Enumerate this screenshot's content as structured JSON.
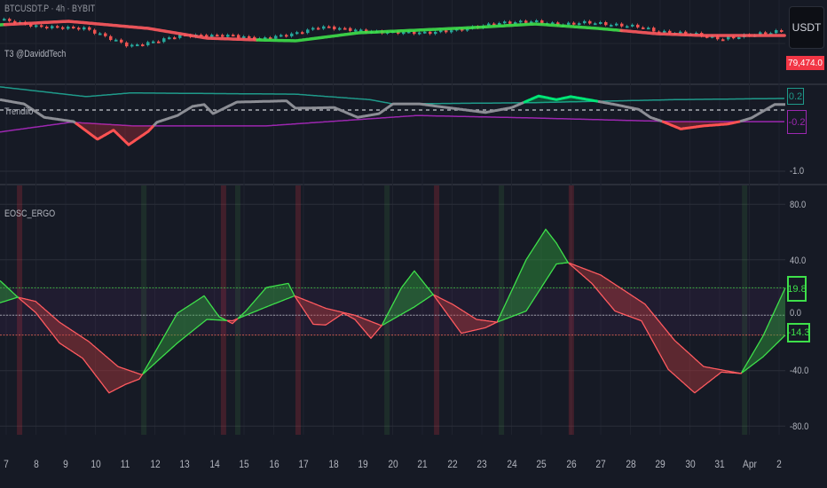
{
  "price_pane": {
    "symbol_label": "BTCUSDT.P · 4h · BYBIT",
    "indicator_label": "T3 @DaviddTech",
    "currency_button": "USDT",
    "last_price_label": "79,474.0"
  },
  "trendilo_pane": {
    "label": "Trendilo",
    "axis_labels": [
      "-1.0"
    ],
    "upper_badge": "0.2",
    "lower_badge": "-0.2"
  },
  "eosc_pane": {
    "label": "EOSC_ERGO",
    "axis_labels": [
      "80.0",
      "40.0",
      "0.0",
      "-40.0",
      "-80.0"
    ],
    "upper_badge": "19.8",
    "lower_badge": "-14.3"
  },
  "colors": {
    "bull": "#4caf50",
    "bull_line": "#3ee04a",
    "bear": "#f23645",
    "bear_line": "#ff5a5f",
    "candle_up": "#26a69a",
    "candle_down": "#ef5350",
    "trendilo_upper": "#1f9a8a",
    "trendilo_lower": "#9c27b0",
    "trendilo_neutral": "#8c8e95",
    "trendilo_bull": "#00e676",
    "trendilo_bear": "#ff5252"
  },
  "chart_data": [
    {
      "type": "line",
      "title": "BTCUSDT.P 4h BYBIT with T3",
      "units": "relative price index (no price scale visible)",
      "price_index": [
        [
          6.79,
          38
        ],
        [
          8.0,
          30
        ],
        [
          9.6,
          28
        ],
        [
          11.1,
          8
        ],
        [
          11.8,
          12
        ],
        [
          12.76,
          20
        ],
        [
          13.66,
          20
        ],
        [
          14.55,
          20
        ],
        [
          15.45,
          16
        ],
        [
          16.64,
          22
        ],
        [
          17.54,
          30
        ],
        [
          18.13,
          28
        ],
        [
          19.33,
          24
        ],
        [
          21.12,
          23
        ],
        [
          22.31,
          27
        ],
        [
          23.51,
          34
        ],
        [
          24.7,
          36
        ],
        [
          25.6,
          32
        ],
        [
          26.49,
          35
        ],
        [
          27.39,
          32
        ],
        [
          28.28,
          30
        ],
        [
          28.88,
          24
        ],
        [
          30.07,
          22
        ],
        [
          30.97,
          16
        ],
        [
          31.87,
          20
        ],
        [
          32.76,
          24
        ],
        [
          33.21,
          26
        ]
      ],
      "t3": [
        [
          6.79,
          32
        ],
        [
          9.09,
          36
        ],
        [
          11.78,
          28
        ],
        [
          13.75,
          17
        ],
        [
          15.45,
          15
        ],
        [
          16.75,
          14
        ],
        [
          18.85,
          23
        ],
        [
          22.76,
          29
        ],
        [
          24.79,
          33
        ],
        [
          26.9,
          28
        ],
        [
          28.88,
          22
        ],
        [
          30.46,
          20
        ],
        [
          33.21,
          20
        ]
      ],
      "t3_trend": [
        {
          "from": 6.79,
          "to": 6.95,
          "dir": "bull"
        },
        {
          "from": 6.95,
          "to": 15.45,
          "dir": "bear"
        },
        {
          "from": 15.45,
          "to": 27.69,
          "dir": "bull"
        },
        {
          "from": 27.69,
          "to": 33.21,
          "dir": "bear"
        }
      ]
    },
    {
      "type": "line",
      "title": "Trendilo",
      "ylim": [
        -1.0,
        0.35
      ],
      "zero_line": 0,
      "value": [
        [
          6.79,
          0.17
        ],
        [
          7.6,
          0.1
        ],
        [
          8.28,
          -0.12
        ],
        [
          9.27,
          -0.19
        ],
        [
          10.07,
          -0.48
        ],
        [
          10.61,
          -0.33
        ],
        [
          11.12,
          -0.57
        ],
        [
          11.78,
          -0.35
        ],
        [
          12.07,
          -0.2
        ],
        [
          12.76,
          -0.09
        ],
        [
          13.27,
          0.06
        ],
        [
          13.66,
          0.09
        ],
        [
          13.96,
          -0.06
        ],
        [
          14.76,
          0.13
        ],
        [
          16.43,
          0.15
        ],
        [
          16.73,
          0.03
        ],
        [
          18.04,
          0.04
        ],
        [
          18.82,
          -0.12
        ],
        [
          19.54,
          -0.06
        ],
        [
          20.01,
          0.1
        ],
        [
          20.91,
          0.1
        ],
        [
          21.51,
          0.06
        ],
        [
          23.12,
          -0.04
        ],
        [
          24.01,
          0.04
        ],
        [
          24.91,
          0.23
        ],
        [
          25.51,
          0.17
        ],
        [
          25.99,
          0.22
        ],
        [
          26.7,
          0.16
        ],
        [
          27.48,
          0.09
        ],
        [
          28.28,
          0.01
        ],
        [
          28.67,
          -0.12
        ],
        [
          29.09,
          -0.19
        ],
        [
          29.69,
          -0.31
        ],
        [
          30.46,
          -0.26
        ],
        [
          31.27,
          -0.23
        ],
        [
          31.66,
          -0.19
        ],
        [
          32.07,
          -0.13
        ],
        [
          32.85,
          0.09
        ],
        [
          33.21,
          0.09
        ]
      ],
      "upper_band": [
        [
          6.79,
          0.38
        ],
        [
          9.69,
          0.22
        ],
        [
          11.18,
          0.28
        ],
        [
          16.73,
          0.26
        ],
        [
          19.24,
          0.17
        ],
        [
          20.01,
          0.1
        ],
        [
          24.7,
          0.12
        ],
        [
          29.48,
          0.17
        ],
        [
          33.21,
          0.19
        ]
      ],
      "lower_band": [
        [
          6.79,
          -0.36
        ],
        [
          9.18,
          -0.2
        ],
        [
          11.27,
          -0.26
        ],
        [
          15.75,
          -0.26
        ],
        [
          20.82,
          -0.09
        ],
        [
          24.7,
          -0.13
        ],
        [
          29.48,
          -0.19
        ],
        [
          33.21,
          -0.19
        ]
      ]
    },
    {
      "type": "area",
      "title": "EOSC_ERGO",
      "ylim": [
        -90,
        95
      ],
      "yticks": [
        80,
        40,
        0,
        -40,
        -80
      ],
      "levels": {
        "upper": 19.8,
        "zero": 0,
        "lower": -14.3
      },
      "fast": [
        [
          6.79,
          25
        ],
        [
          7.39,
          13
        ],
        [
          7.99,
          2
        ],
        [
          8.79,
          -20
        ],
        [
          9.57,
          -31
        ],
        [
          10.46,
          -56
        ],
        [
          11.0,
          -50
        ],
        [
          11.48,
          -46
        ],
        [
          11.57,
          -43
        ],
        [
          12.76,
          1.5
        ],
        [
          13.66,
          14
        ],
        [
          14.16,
          -1
        ],
        [
          14.61,
          -6
        ],
        [
          15.06,
          3
        ],
        [
          15.75,
          20
        ],
        [
          16.49,
          23
        ],
        [
          16.7,
          14
        ],
        [
          17.33,
          -6.5
        ],
        [
          17.75,
          -7
        ],
        [
          18.34,
          1.5
        ],
        [
          18.73,
          -3
        ],
        [
          19.27,
          -16.6
        ],
        [
          19.63,
          -7.5
        ],
        [
          20.3,
          20
        ],
        [
          20.73,
          32
        ],
        [
          21.36,
          15
        ],
        [
          22.31,
          -13
        ],
        [
          23.12,
          -9
        ],
        [
          23.51,
          -5
        ],
        [
          24.49,
          40
        ],
        [
          25.15,
          62
        ],
        [
          25.51,
          52
        ],
        [
          25.9,
          38
        ],
        [
          26.7,
          23
        ],
        [
          27.48,
          3
        ],
        [
          28.37,
          -4
        ],
        [
          29.27,
          -39
        ],
        [
          30.16,
          -56
        ],
        [
          31.06,
          -41
        ],
        [
          31.72,
          -42
        ],
        [
          32.46,
          -15
        ],
        [
          33.21,
          19.8
        ]
      ],
      "slow": [
        [
          6.79,
          9
        ],
        [
          7.39,
          13
        ],
        [
          7.99,
          10
        ],
        [
          8.79,
          -5
        ],
        [
          9.78,
          -19
        ],
        [
          10.76,
          -37
        ],
        [
          11.57,
          -43
        ],
        [
          12.76,
          -20
        ],
        [
          13.75,
          -3
        ],
        [
          14.61,
          -4
        ],
        [
          15.75,
          6
        ],
        [
          16.7,
          14
        ],
        [
          17.75,
          5
        ],
        [
          18.73,
          0
        ],
        [
          19.63,
          -7.5
        ],
        [
          20.73,
          6
        ],
        [
          21.36,
          15
        ],
        [
          22.01,
          8
        ],
        [
          22.82,
          -3
        ],
        [
          23.51,
          -5
        ],
        [
          24.49,
          3
        ],
        [
          25.51,
          37
        ],
        [
          25.9,
          38
        ],
        [
          27.0,
          29
        ],
        [
          28.49,
          8
        ],
        [
          29.48,
          -18
        ],
        [
          30.46,
          -37
        ],
        [
          31.72,
          -42
        ],
        [
          32.46,
          -30
        ],
        [
          33.21,
          -14.3
        ]
      ],
      "signal_bars": [
        {
          "day": 7.45,
          "dir": "bear"
        },
        {
          "day": 11.63,
          "dir": "bull"
        },
        {
          "day": 14.31,
          "dir": "bear"
        },
        {
          "day": 14.79,
          "dir": "bull"
        },
        {
          "day": 16.82,
          "dir": "bear"
        },
        {
          "day": 19.81,
          "dir": "bull"
        },
        {
          "day": 21.48,
          "dir": "bear"
        },
        {
          "day": 23.66,
          "dir": "bull"
        },
        {
          "day": 26.01,
          "dir": "bear"
        },
        {
          "day": 31.84,
          "dir": "bull"
        }
      ]
    }
  ],
  "time_axis": {
    "labels": [
      "7",
      "8",
      "9",
      "10",
      "11",
      "12",
      "13",
      "14",
      "15",
      "16",
      "17",
      "18",
      "19",
      "20",
      "21",
      "22",
      "23",
      "24",
      "25",
      "26",
      "27",
      "28",
      "29",
      "30",
      "31",
      "Apr",
      "2"
    ],
    "first_day": 7
  }
}
